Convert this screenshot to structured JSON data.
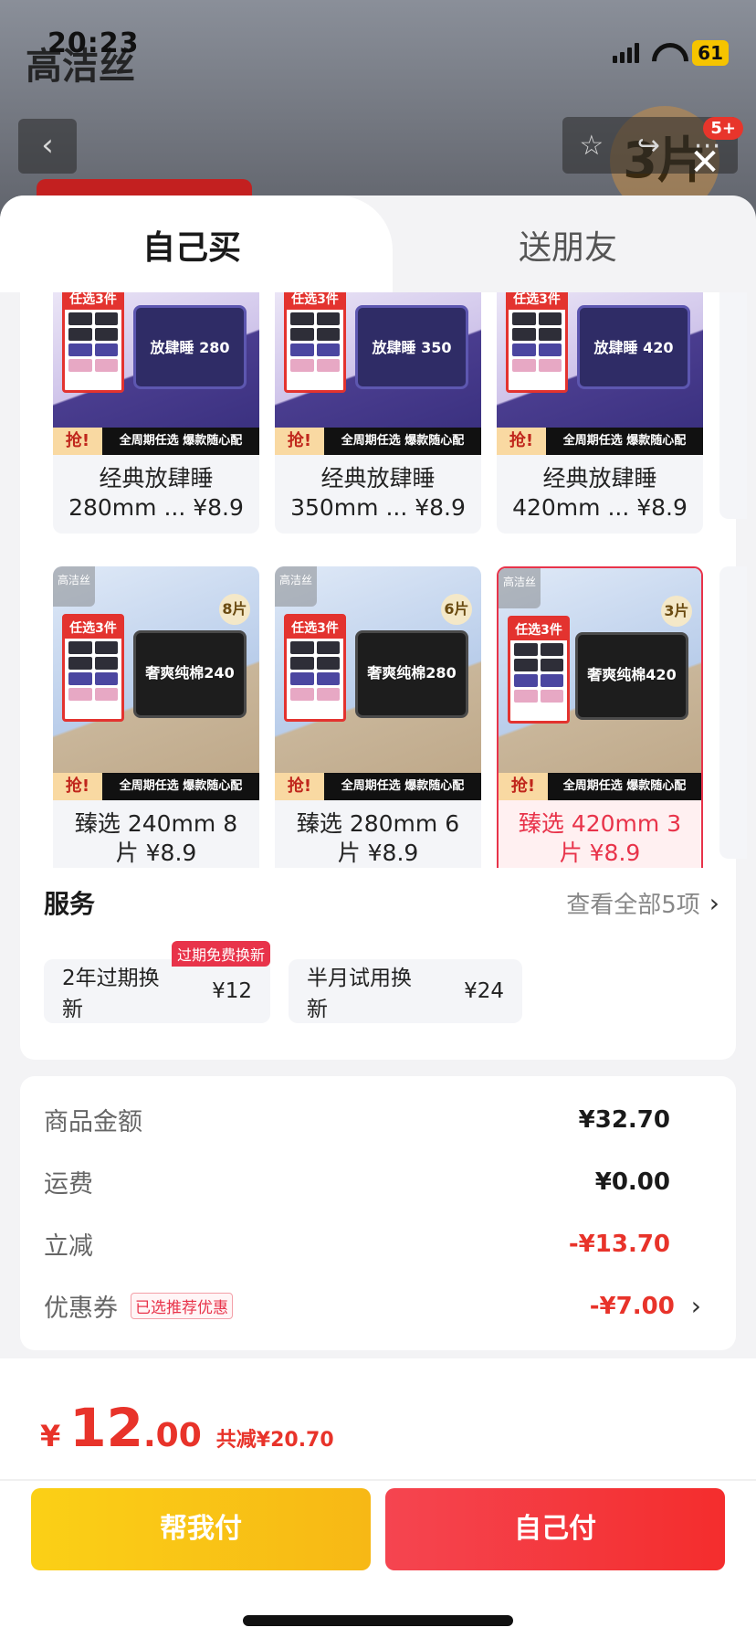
{
  "status": {
    "time": "20:23",
    "battery": "61"
  },
  "background": {
    "brand_text": "高洁丝",
    "promo_text": "3片",
    "notification_count": "5+"
  },
  "tabs": [
    {
      "label": "自己买"
    },
    {
      "label": "送朋友"
    }
  ],
  "slogan": {
    "choose": "任选3件",
    "grab": "抢!",
    "text": "全周期任选 爆款随心配"
  },
  "products_row1": [
    {
      "pack_label": "放肆睡 280",
      "name": "经典放肆睡 280mm ... ¥8.9"
    },
    {
      "pack_label": "放肆睡 350",
      "name": "经典放肆睡 350mm ... ¥8.9"
    },
    {
      "pack_label": "放肆睡 420",
      "name": "经典放肆睡 420mm ... ¥8.9"
    }
  ],
  "products_row2": [
    {
      "pack_label": "奢爽纯棉240",
      "count": "8片",
      "name": "臻选 240mm 8 片 ¥8.9",
      "selected": false
    },
    {
      "pack_label": "奢爽纯棉280",
      "count": "6片",
      "name": "臻选 280mm 6 片 ¥8.9",
      "selected": false
    },
    {
      "pack_label": "奢爽纯棉420",
      "count": "3片",
      "name": "臻选 420mm 3 片 ¥8.9",
      "selected": true
    }
  ],
  "corner_logo": "高洁丝",
  "services": {
    "title": "服务",
    "more": "查看全部5项",
    "items": [
      {
        "name": "2年过期换新",
        "price": "¥12",
        "tag": "过期免费换新"
      },
      {
        "name": "半月试用换新",
        "price": "¥24"
      }
    ]
  },
  "pricing": {
    "goods_label": "商品金额",
    "goods_value": "¥32.70",
    "shipping_label": "运费",
    "shipping_value": "¥0.00",
    "discount_label": "立减",
    "discount_value": "-¥13.70",
    "coupon_label": "优惠券",
    "coupon_tag": "已选推荐优惠",
    "coupon_value": "-¥7.00"
  },
  "total": {
    "currency": "¥",
    "integer": "12",
    "decimal": ".00",
    "saved": "共减¥20.70"
  },
  "buttons": {
    "helper": "帮我付",
    "self": "自己付"
  },
  "colors": {
    "accent_red": "#e8332a",
    "helper_yellow": "#fbd016",
    "selected_border": "#e8334a"
  }
}
